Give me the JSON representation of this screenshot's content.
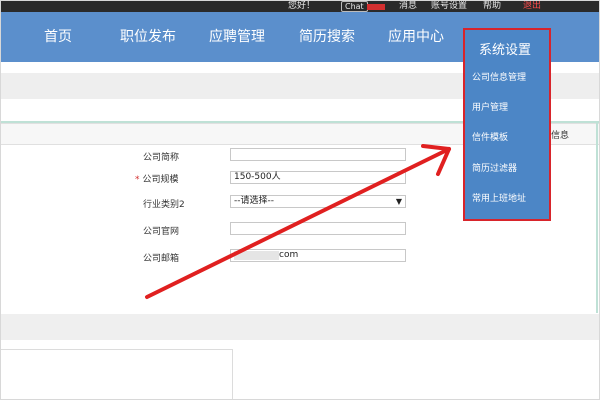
{
  "topbar": {
    "greeting": "您好！",
    "chat": "Chat",
    "items": [
      "消息",
      "账号设置",
      "帮助"
    ],
    "logout": "退出"
  },
  "nav": {
    "items": [
      "首页",
      "职位发布",
      "应聘管理",
      "简历搜索",
      "应用中心",
      "系统设置"
    ]
  },
  "dropdown": {
    "title": "系统设置",
    "items": [
      "公司信息管理",
      "用户管理",
      "信件模板",
      "简历过滤器",
      "常用上班地址"
    ]
  },
  "panel": {
    "tail_text": "信息"
  },
  "form": {
    "short_name_label": "公司简称",
    "short_name_value": "",
    "size_label": "公司规模",
    "size_value": "150-500人",
    "industry_label": "行业类别2",
    "industry_value": "--请选择--",
    "website_label": "公司官网",
    "website_value": "",
    "email_label": "公司邮箱",
    "email_suffix": "com"
  },
  "colors": {
    "nav_bg": "#5b8fcc",
    "dropdown_bg": "#4c86c6",
    "highlight_red": "#d8242b"
  }
}
